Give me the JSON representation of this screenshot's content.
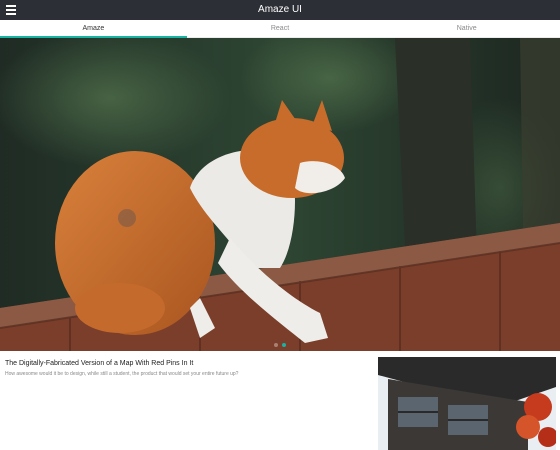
{
  "header": {
    "title": "Amaze UI",
    "menu_icon": "menu-icon"
  },
  "tabs": [
    {
      "label": "Amaze",
      "active": true
    },
    {
      "label": "React",
      "active": false
    },
    {
      "label": "Native",
      "active": false
    }
  ],
  "slider": {
    "slide_count": 2,
    "active_index": 1,
    "image": "orange-and-white-cat-on-brick-wall-photo"
  },
  "article": {
    "title": "The Digitally-Fabricated Version of a Map With Red Pins In It",
    "description": "How awesome would it be to design, while still a student, the product that would set your entire future up?",
    "thumbnail": "japanese-house-with-red-maple-photo"
  },
  "colors": {
    "header_bg": "#2d2f36",
    "accent": "#17b3a3"
  }
}
